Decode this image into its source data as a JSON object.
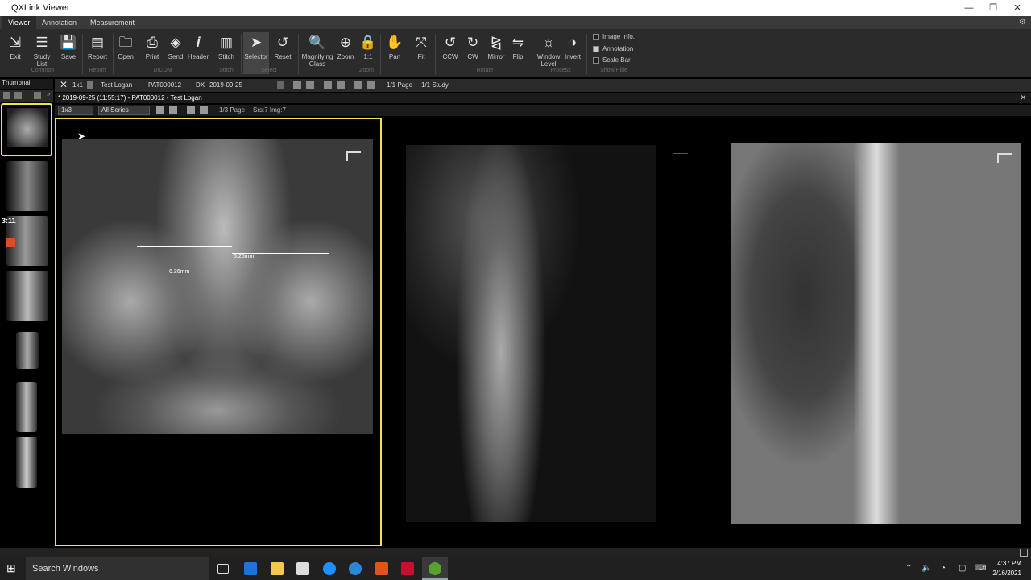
{
  "window": {
    "title": "QXLink Viewer",
    "minimize": "—",
    "maximize": "❐",
    "close": "✕"
  },
  "tabs": [
    {
      "label": "Viewer"
    },
    {
      "label": "Annotation"
    },
    {
      "label": "Measurement"
    }
  ],
  "ribbon": {
    "buttons": [
      {
        "label": "Exit",
        "icon": "⇲"
      },
      {
        "label": "Study\nList",
        "icon": "☰"
      },
      {
        "label": "Save",
        "icon": "💾"
      },
      {
        "label": "Report",
        "icon": "▤"
      },
      {
        "label": "Open",
        "icon": "🗀"
      },
      {
        "label": "Print",
        "icon": "⎙"
      },
      {
        "label": "Send",
        "icon": "◈"
      },
      {
        "label": "Header",
        "icon": "𝒊"
      },
      {
        "label": "Stitch",
        "icon": "▥"
      },
      {
        "label": "Selector",
        "icon": "➤"
      },
      {
        "label": "Reset",
        "icon": "↺"
      },
      {
        "label": "Magnifying\nGlass",
        "icon": "🔍"
      },
      {
        "label": "Zoom",
        "icon": "⊕"
      },
      {
        "label": "1:1",
        "icon": "🔒"
      },
      {
        "label": "Pan",
        "icon": "✋"
      },
      {
        "label": "Fit",
        "icon": "⤧"
      },
      {
        "label": "CCW",
        "icon": "↺"
      },
      {
        "label": "CW",
        "icon": "↻"
      },
      {
        "label": "Mirror",
        "icon": "⧎"
      },
      {
        "label": "Flip",
        "icon": "⇋"
      },
      {
        "label": "Window\nLevel",
        "icon": "☼"
      },
      {
        "label": "Invert",
        "icon": "◑"
      }
    ],
    "groups": [
      "Common",
      "Report",
      "DICOM",
      "Stitch",
      "Select",
      "Zoom",
      "Rotate",
      "Process",
      "Show/Hide"
    ],
    "checks": [
      {
        "label": "Image Info."
      },
      {
        "label": "Annotation"
      },
      {
        "label": "Scale Bar"
      }
    ]
  },
  "thumbnail_panel": {
    "title": "Thumbnail",
    "timer": "3:11"
  },
  "viewer_toolbar": {
    "layout": "1x1",
    "patient_name": "Test Logan",
    "patient_id": "PAT000012",
    "modality": "DX",
    "study_date": "2019-09-25",
    "page": "1/1 Page",
    "study": "1/1 Study"
  },
  "study_header": "* 2019-09-25 (11:55:17) - PAT000012 - Test Logan",
  "series_bar": {
    "layout": "1x3",
    "filter": "All Series",
    "page": "1/3 Page",
    "srs": "Srs:7 Img:7"
  },
  "measurements": [
    {
      "label": "6.26mm"
    },
    {
      "label": "6.26mm"
    }
  ],
  "taskbar": {
    "search": "Search Windows",
    "time": "4:37 PM",
    "date": "2/16/2021"
  },
  "colors": {
    "accent": "#f5e53a",
    "ribbon": "#2b2b2b"
  }
}
